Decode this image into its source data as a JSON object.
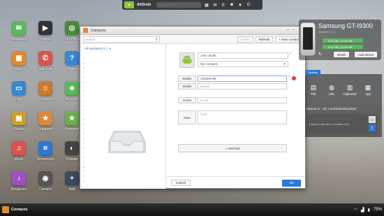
{
  "topbar": {
    "brand": "AirDroid",
    "search_placeholder": "Search"
  },
  "desktop_icons": [
    {
      "label": "Messages",
      "color": "#5cb85c",
      "glyph": "✉"
    },
    {
      "label": "Videos",
      "color": "#333333",
      "glyph": "▶"
    },
    {
      "label": "Find Phone",
      "color": "#4a8a3a",
      "glyph": "◎"
    },
    {
      "label": "Apps",
      "color": "#e08a2b",
      "glyph": "▦"
    },
    {
      "label": "Call Logs",
      "color": "#d9534f",
      "glyph": "✆"
    },
    {
      "label": "Help",
      "color": "#3a86d0",
      "glyph": "?"
    },
    {
      "label": "Files",
      "color": "#3a86d0",
      "glyph": "▭"
    },
    {
      "label": "Contacts",
      "color": "#c97a2e",
      "glyph": "☺"
    },
    {
      "label": "Account",
      "color": "#5cb85c",
      "glyph": "☻"
    },
    {
      "label": "Photos",
      "color": "#c9a02e",
      "glyph": "▣"
    },
    {
      "label": "Frequent",
      "color": "#d98a3a",
      "glyph": "★"
    },
    {
      "label": "Premium",
      "color": "#6ab04c",
      "glyph": "★"
    },
    {
      "label": "Music",
      "color": "#d9534f",
      "glyph": "♫"
    },
    {
      "label": "Screenshot",
      "color": "#2b78d6",
      "glyph": "⌗"
    },
    {
      "label": "Themer",
      "color": "#444444",
      "glyph": "◐"
    },
    {
      "label": "Ringtones",
      "color": "#a050c0",
      "glyph": "♪"
    },
    {
      "label": "Camera",
      "color": "#555555",
      "glyph": "◉"
    },
    {
      "label": "Add",
      "color": "#3a4a5a",
      "glyph": "+"
    }
  ],
  "contacts_window": {
    "title": "Contacts",
    "search_placeholder": "Search",
    "delete_label": "Delete",
    "refresh_label": "Refresh",
    "new_contact_label": "+ New contact",
    "group_label": "All Numbers( 0 )",
    "name_value": "John Smith",
    "group_select": "My Contacts",
    "mobile_label_1": "Mobile",
    "mobile_value_1": "123456789",
    "mobile_label_2": "Mobile",
    "mobile_placeholder_2": "Mobile",
    "home_label": "Home",
    "email_placeholder": "Email",
    "note_label": "Note",
    "note_placeholder": "Note",
    "add_field_label": "+ Add field",
    "cancel_label": "Cancel",
    "ok_label": "OK"
  },
  "device": {
    "name": "Samsung GT-I9300",
    "version": "Android 4.1.1",
    "storage_1": "8.57 GB | 11.35 GB",
    "storage_2": "8.57 GB | 11.25 GB",
    "detail_label": "Detail",
    "add_device_label": "Add device"
  },
  "toolbox": {
    "title": "Toolbox",
    "tools": [
      {
        "label": "File",
        "glyph": "▤"
      },
      {
        "label": "URL",
        "glyph": "◍"
      },
      {
        "label": "Clipboard",
        "glyph": "▥"
      },
      {
        "label": "App",
        "glyph": "▦"
      }
    ],
    "upload_label": "Upload to : SD Card/airdroid/upload",
    "drag_text": "Drag & Drop files or folders here"
  },
  "taskbar": {
    "active_app": "Contacts",
    "battery": "75%"
  }
}
